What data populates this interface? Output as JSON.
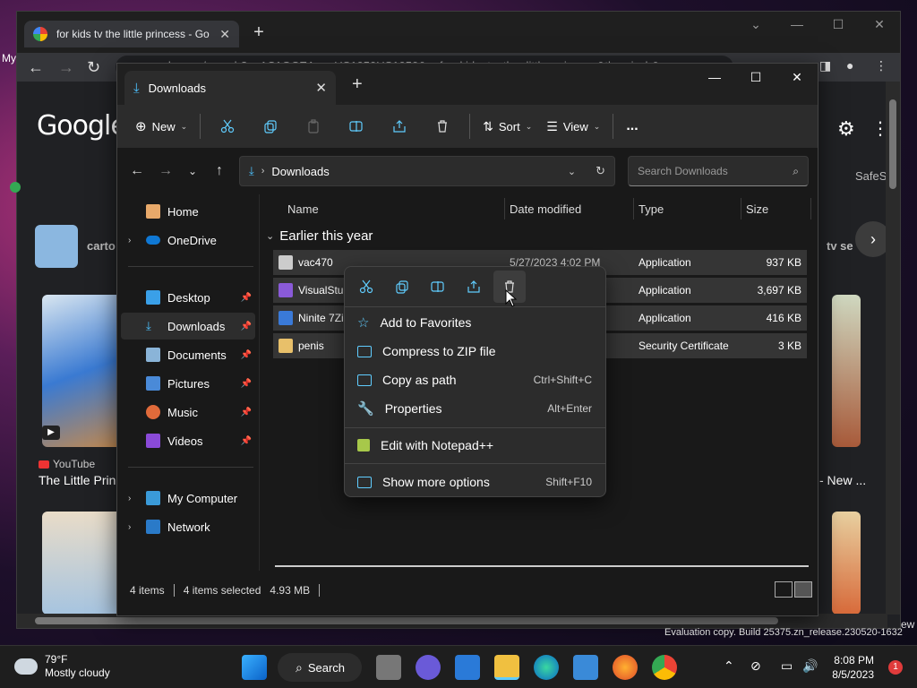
{
  "browser": {
    "tab_title": "for kids tv the little princess - Go",
    "url": "google.com/search?q=1C1GCEA_enUS1050US1050&q=for+kids+tv+the+little+princess&tbm=isch&sour",
    "logo": "Google",
    "side_left_text": "My",
    "cartoon_label": "carto",
    "tv_series_label": "tv se",
    "safe_label": "SafeS",
    "yt_source": "YouTube",
    "yt_title": "The Little Prin",
    "new_label": "- New ...",
    "ew_label": "ew"
  },
  "explorer": {
    "tab_label": "Downloads",
    "toolbar": {
      "new_label": "New",
      "sort_label": "Sort",
      "view_label": "View",
      "more_label": "..."
    },
    "address_path": "Downloads",
    "search_placeholder": "Search Downloads",
    "sidebar": {
      "home": "Home",
      "onedrive": "OneDrive",
      "desktop": "Desktop",
      "downloads": "Downloads",
      "documents": "Documents",
      "pictures": "Pictures",
      "music": "Music",
      "videos": "Videos",
      "my_computer": "My Computer",
      "network": "Network"
    },
    "columns": {
      "name": "Name",
      "date": "Date modified",
      "type": "Type",
      "size": "Size"
    },
    "group_label": "Earlier this year",
    "files": [
      {
        "name": "vac470",
        "date": "5/27/2023 4:02 PM",
        "type": "Application",
        "size": "937 KB"
      },
      {
        "name": "VisualStud",
        "date": "",
        "type": "Application",
        "size": "3,697 KB"
      },
      {
        "name": "Ninite 7Zip",
        "date": "",
        "type": "Application",
        "size": "416 KB"
      },
      {
        "name": "penis",
        "date": "",
        "type": "Security Certificate",
        "size": "3 KB"
      }
    ],
    "status": {
      "items": "4 items",
      "selected": "4 items selected",
      "size": "4.93 MB"
    }
  },
  "context_menu": {
    "items": [
      {
        "label": "Add to Favorites",
        "shortcut": ""
      },
      {
        "label": "Compress to ZIP file",
        "shortcut": ""
      },
      {
        "label": "Copy as path",
        "shortcut": "Ctrl+Shift+C"
      },
      {
        "label": "Properties",
        "shortcut": "Alt+Enter"
      },
      {
        "label": "Edit with Notepad++",
        "shortcut": ""
      },
      {
        "label": "Show more options",
        "shortcut": "Shift+F10"
      }
    ]
  },
  "taskbar": {
    "temp": "79°F",
    "weather": "Mostly cloudy",
    "search_label": "Search",
    "time": "8:08 PM",
    "date": "8/5/2023",
    "notification_count": "1"
  },
  "watermark": "Evaluation copy. Build 25375.zn_release.230520-1632",
  "colors": {
    "accent": "#0078d4",
    "explorer_bg": "#191919",
    "selected_row": "#353535"
  }
}
